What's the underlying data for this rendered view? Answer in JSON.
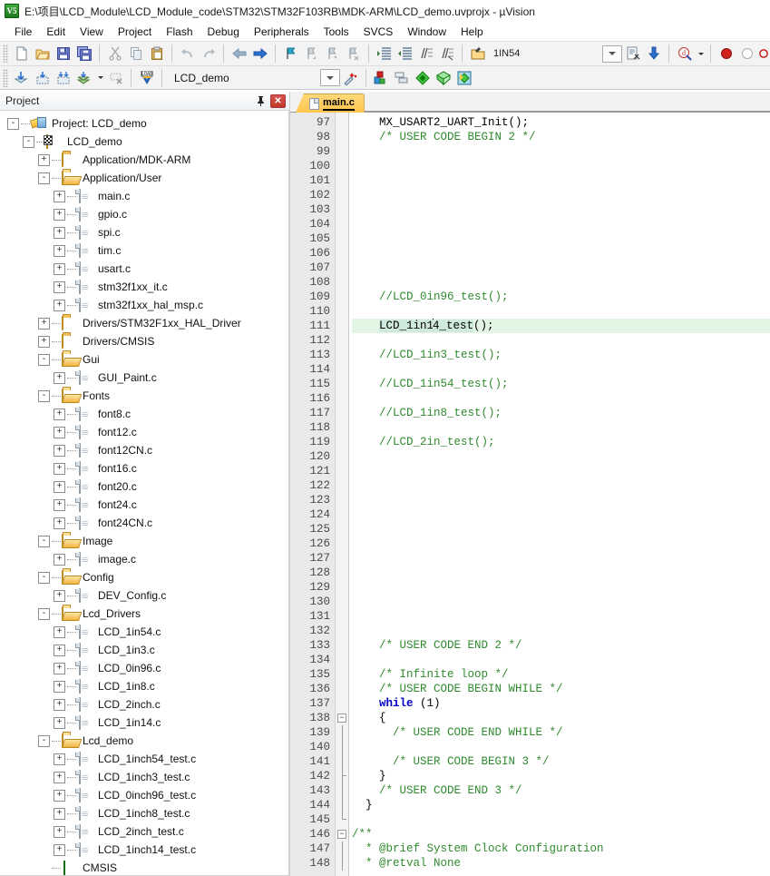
{
  "window": {
    "icon": "uvision-icon",
    "icon_text": "V5",
    "title": "E:\\项目\\LCD_Module\\LCD_Module_code\\STM32\\STM32F103RB\\MDK-ARM\\LCD_demo.uvprojx - µVision"
  },
  "menubar": {
    "items": [
      {
        "label": "File"
      },
      {
        "label": "Edit"
      },
      {
        "label": "View"
      },
      {
        "label": "Project"
      },
      {
        "label": "Flash"
      },
      {
        "label": "Debug"
      },
      {
        "label": "Peripherals"
      },
      {
        "label": "Tools"
      },
      {
        "label": "SVCS"
      },
      {
        "label": "Window"
      },
      {
        "label": "Help"
      }
    ]
  },
  "toolbar1": {
    "target_label": "1IN54",
    "buttons": [
      {
        "name": "new-file-icon"
      },
      {
        "name": "open-file-icon"
      },
      {
        "name": "save-icon"
      },
      {
        "name": "save-all-icon"
      },
      {
        "name": "cut-icon"
      },
      {
        "name": "copy-icon"
      },
      {
        "name": "paste-icon"
      },
      {
        "name": "undo-icon"
      },
      {
        "name": "redo-icon"
      },
      {
        "name": "navigate-backward-icon"
      },
      {
        "name": "navigate-forward-icon"
      },
      {
        "name": "bookmark-toggle-icon"
      },
      {
        "name": "bookmark-prev-icon"
      },
      {
        "name": "bookmark-next-icon"
      },
      {
        "name": "bookmark-clear-icon"
      },
      {
        "name": "indent-icon"
      },
      {
        "name": "outdent-icon"
      },
      {
        "name": "comment-icon"
      },
      {
        "name": "uncomment-icon"
      },
      {
        "name": "target-options-icon"
      },
      {
        "name": "configuration-wizard-icon"
      },
      {
        "name": "download-icon"
      },
      {
        "name": "debug-session-icon"
      },
      {
        "name": "breakpoint-insert-icon"
      },
      {
        "name": "breakpoint-disable-icon"
      },
      {
        "name": "breakpoint-kill-icon"
      }
    ]
  },
  "toolbar2": {
    "project_name": "LCD_demo",
    "buttons": [
      {
        "name": "translate-icon"
      },
      {
        "name": "build-icon"
      },
      {
        "name": "rebuild-icon"
      },
      {
        "name": "batch-build-icon"
      },
      {
        "name": "stop-build-icon"
      },
      {
        "name": "load-flash-icon"
      },
      {
        "name": "target-options-wizard-icon"
      },
      {
        "name": "manage-components-icon"
      },
      {
        "name": "multi-project-icon"
      },
      {
        "name": "pack-installer-icon"
      },
      {
        "name": "run-time-env-icon"
      },
      {
        "name": "software-packs-icon"
      }
    ]
  },
  "project_panel": {
    "title": "Project",
    "pin_icon": "pin-icon",
    "close_icon": "close-icon",
    "tree": [
      {
        "label": "Project: LCD_demo",
        "indent": 0,
        "icon": "project-root-icon",
        "expander": "-"
      },
      {
        "label": "LCD_demo",
        "indent": 1,
        "icon": "target-icon",
        "expander": "-"
      },
      {
        "label": "Application/MDK-ARM",
        "indent": 2,
        "icon": "folder-closed-icon",
        "expander": "+"
      },
      {
        "label": "Application/User",
        "indent": 2,
        "icon": "folder-open-icon",
        "expander": "-"
      },
      {
        "label": "main.c",
        "indent": 3,
        "icon": "c-file-icon",
        "expander": "+"
      },
      {
        "label": "gpio.c",
        "indent": 3,
        "icon": "c-file-icon",
        "expander": "+"
      },
      {
        "label": "spi.c",
        "indent": 3,
        "icon": "c-file-icon",
        "expander": "+"
      },
      {
        "label": "tim.c",
        "indent": 3,
        "icon": "c-file-icon",
        "expander": "+"
      },
      {
        "label": "usart.c",
        "indent": 3,
        "icon": "c-file-icon",
        "expander": "+"
      },
      {
        "label": "stm32f1xx_it.c",
        "indent": 3,
        "icon": "c-file-icon",
        "expander": "+"
      },
      {
        "label": "stm32f1xx_hal_msp.c",
        "indent": 3,
        "icon": "c-file-icon",
        "expander": "+"
      },
      {
        "label": "Drivers/STM32F1xx_HAL_Driver",
        "indent": 2,
        "icon": "folder-closed-icon",
        "expander": "+"
      },
      {
        "label": "Drivers/CMSIS",
        "indent": 2,
        "icon": "folder-closed-icon",
        "expander": "+"
      },
      {
        "label": "Gui",
        "indent": 2,
        "icon": "folder-open-icon",
        "expander": "-"
      },
      {
        "label": "GUI_Paint.c",
        "indent": 3,
        "icon": "c-file-icon",
        "expander": "+"
      },
      {
        "label": "Fonts",
        "indent": 2,
        "icon": "folder-open-icon",
        "expander": "-"
      },
      {
        "label": "font8.c",
        "indent": 3,
        "icon": "c-file-icon",
        "expander": "+"
      },
      {
        "label": "font12.c",
        "indent": 3,
        "icon": "c-file-icon",
        "expander": "+"
      },
      {
        "label": "font12CN.c",
        "indent": 3,
        "icon": "c-file-icon",
        "expander": "+"
      },
      {
        "label": "font16.c",
        "indent": 3,
        "icon": "c-file-icon",
        "expander": "+"
      },
      {
        "label": "font20.c",
        "indent": 3,
        "icon": "c-file-icon",
        "expander": "+"
      },
      {
        "label": "font24.c",
        "indent": 3,
        "icon": "c-file-icon",
        "expander": "+"
      },
      {
        "label": "font24CN.c",
        "indent": 3,
        "icon": "c-file-icon",
        "expander": "+"
      },
      {
        "label": "Image",
        "indent": 2,
        "icon": "folder-open-icon",
        "expander": "-"
      },
      {
        "label": "image.c",
        "indent": 3,
        "icon": "c-file-icon",
        "expander": "+"
      },
      {
        "label": "Config",
        "indent": 2,
        "icon": "folder-open-icon",
        "expander": "-"
      },
      {
        "label": "DEV_Config.c",
        "indent": 3,
        "icon": "c-file-icon",
        "expander": "+"
      },
      {
        "label": "Lcd_Drivers",
        "indent": 2,
        "icon": "folder-open-icon",
        "expander": "-"
      },
      {
        "label": "LCD_1in54.c",
        "indent": 3,
        "icon": "c-file-icon",
        "expander": "+"
      },
      {
        "label": "LCD_1in3.c",
        "indent": 3,
        "icon": "c-file-icon",
        "expander": "+"
      },
      {
        "label": "LCD_0in96.c",
        "indent": 3,
        "icon": "c-file-icon",
        "expander": "+"
      },
      {
        "label": "LCD_1in8.c",
        "indent": 3,
        "icon": "c-file-icon",
        "expander": "+"
      },
      {
        "label": "LCD_2inch.c",
        "indent": 3,
        "icon": "c-file-icon",
        "expander": "+"
      },
      {
        "label": "LCD_1in14.c",
        "indent": 3,
        "icon": "c-file-icon",
        "expander": "+"
      },
      {
        "label": "Lcd_demo",
        "indent": 2,
        "icon": "folder-open-icon",
        "expander": "-"
      },
      {
        "label": "LCD_1inch54_test.c",
        "indent": 3,
        "icon": "c-file-icon",
        "expander": "+"
      },
      {
        "label": "LCD_1inch3_test.c",
        "indent": 3,
        "icon": "c-file-icon",
        "expander": "+"
      },
      {
        "label": "LCD_0inch96_test.c",
        "indent": 3,
        "icon": "c-file-icon",
        "expander": "+"
      },
      {
        "label": "LCD_1inch8_test.c",
        "indent": 3,
        "icon": "c-file-icon",
        "expander": "+"
      },
      {
        "label": "LCD_2inch_test.c",
        "indent": 3,
        "icon": "c-file-icon",
        "expander": "+"
      },
      {
        "label": "LCD_1inch14_test.c",
        "indent": 3,
        "icon": "c-file-icon",
        "expander": "+"
      },
      {
        "label": "CMSIS",
        "indent": 2,
        "icon": "cmsis-diamond-icon",
        "expander": "none"
      }
    ]
  },
  "editor": {
    "tabs": [
      {
        "label": "main.c",
        "active": true
      }
    ],
    "first_line": 97,
    "lines": [
      {
        "n": 97,
        "fold": "",
        "segments": [
          {
            "t": "    MX_USART2_UART_Init();",
            "c": "txt"
          }
        ]
      },
      {
        "n": 98,
        "fold": "",
        "segments": [
          {
            "t": "    /* USER CODE BEGIN 2 */",
            "c": "cmt"
          }
        ]
      },
      {
        "n": 99,
        "fold": "",
        "segments": []
      },
      {
        "n": 100,
        "fold": "",
        "segments": []
      },
      {
        "n": 101,
        "fold": "",
        "segments": []
      },
      {
        "n": 102,
        "fold": "",
        "segments": []
      },
      {
        "n": 103,
        "fold": "",
        "segments": []
      },
      {
        "n": 104,
        "fold": "",
        "segments": []
      },
      {
        "n": 105,
        "fold": "",
        "segments": []
      },
      {
        "n": 106,
        "fold": "",
        "segments": []
      },
      {
        "n": 107,
        "fold": "",
        "segments": []
      },
      {
        "n": 108,
        "fold": "",
        "segments": []
      },
      {
        "n": 109,
        "fold": "",
        "segments": [
          {
            "t": "    //LCD_0in96_test();",
            "c": "cmt"
          }
        ]
      },
      {
        "n": 110,
        "fold": "",
        "segments": []
      },
      {
        "n": 111,
        "fold": "",
        "current": true,
        "segments": [
          {
            "t": "    ",
            "c": "txt"
          },
          {
            "t": "LCD_1in1",
            "c": "sel"
          },
          {
            "t": "CARET",
            "c": "caret"
          },
          {
            "t": "4_test",
            "c": "sel"
          },
          {
            "t": "();",
            "c": "txt"
          }
        ]
      },
      {
        "n": 112,
        "fold": "",
        "segments": []
      },
      {
        "n": 113,
        "fold": "",
        "segments": [
          {
            "t": "    //LCD_1in3_test();",
            "c": "cmt"
          }
        ]
      },
      {
        "n": 114,
        "fold": "",
        "segments": []
      },
      {
        "n": 115,
        "fold": "",
        "segments": [
          {
            "t": "    //LCD_1in54_test();",
            "c": "cmt"
          }
        ]
      },
      {
        "n": 116,
        "fold": "",
        "segments": []
      },
      {
        "n": 117,
        "fold": "",
        "segments": [
          {
            "t": "    //LCD_1in8_test();",
            "c": "cmt"
          }
        ]
      },
      {
        "n": 118,
        "fold": "",
        "segments": []
      },
      {
        "n": 119,
        "fold": "",
        "segments": [
          {
            "t": "    //LCD_2in_test();",
            "c": "cmt"
          }
        ]
      },
      {
        "n": 120,
        "fold": "",
        "segments": []
      },
      {
        "n": 121,
        "fold": "",
        "segments": []
      },
      {
        "n": 122,
        "fold": "",
        "segments": []
      },
      {
        "n": 123,
        "fold": "",
        "segments": []
      },
      {
        "n": 124,
        "fold": "",
        "segments": []
      },
      {
        "n": 125,
        "fold": "",
        "segments": []
      },
      {
        "n": 126,
        "fold": "",
        "segments": []
      },
      {
        "n": 127,
        "fold": "",
        "segments": []
      },
      {
        "n": 128,
        "fold": "",
        "segments": []
      },
      {
        "n": 129,
        "fold": "",
        "segments": []
      },
      {
        "n": 130,
        "fold": "",
        "segments": []
      },
      {
        "n": 131,
        "fold": "",
        "segments": []
      },
      {
        "n": 132,
        "fold": "",
        "segments": []
      },
      {
        "n": 133,
        "fold": "",
        "segments": [
          {
            "t": "    /* USER CODE END 2 */",
            "c": "cmt"
          }
        ]
      },
      {
        "n": 134,
        "fold": "",
        "segments": []
      },
      {
        "n": 135,
        "fold": "",
        "segments": [
          {
            "t": "    /* Infinite loop */",
            "c": "cmt"
          }
        ]
      },
      {
        "n": 136,
        "fold": "",
        "segments": [
          {
            "t": "    /* USER CODE BEGIN WHILE */",
            "c": "cmt"
          }
        ]
      },
      {
        "n": 137,
        "fold": "",
        "segments": [
          {
            "t": "    ",
            "c": "txt"
          },
          {
            "t": "while",
            "c": "kw"
          },
          {
            "t": " (1)",
            "c": "txt"
          }
        ]
      },
      {
        "n": 138,
        "fold": "box",
        "segments": [
          {
            "t": "    {",
            "c": "txt"
          }
        ]
      },
      {
        "n": 139,
        "fold": "line",
        "segments": [
          {
            "t": "      /* USER CODE END WHILE */",
            "c": "cmt"
          }
        ]
      },
      {
        "n": 140,
        "fold": "line",
        "segments": []
      },
      {
        "n": 141,
        "fold": "line",
        "segments": [
          {
            "t": "      /* USER CODE BEGIN 3 */",
            "c": "cmt"
          }
        ]
      },
      {
        "n": 142,
        "fold": "endin",
        "segments": [
          {
            "t": "    }",
            "c": "txt"
          }
        ]
      },
      {
        "n": 143,
        "fold": "line",
        "segments": [
          {
            "t": "    /* USER CODE END 3 */",
            "c": "cmt"
          }
        ]
      },
      {
        "n": 144,
        "fold": "line",
        "segments": [
          {
            "t": "  }",
            "c": "txt"
          }
        ]
      },
      {
        "n": 145,
        "fold": "end",
        "segments": []
      },
      {
        "n": 146,
        "fold": "box",
        "segments": [
          {
            "t": "/**",
            "c": "cmt"
          }
        ]
      },
      {
        "n": 147,
        "fold": "line",
        "segments": [
          {
            "t": "  * @brief System Clock Configuration",
            "c": "cmt"
          }
        ]
      },
      {
        "n": 148,
        "fold": "line",
        "segments": [
          {
            "t": "  * @retval None",
            "c": "cmt"
          }
        ]
      }
    ]
  },
  "colors": {
    "comment": "#2f8a2f",
    "keyword": "#0000c8",
    "current_line": "#e3f6e3",
    "selection": "#cfe9dd",
    "tab_active": "#ffc44d",
    "gutter_bg": "#e9e9e9"
  }
}
